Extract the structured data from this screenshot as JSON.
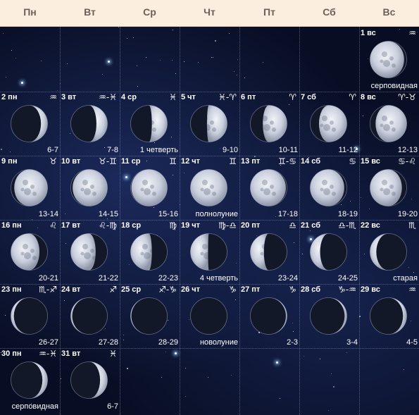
{
  "header": {
    "days": [
      "Пн",
      "Вт",
      "Ср",
      "Чт",
      "Пт",
      "Сб",
      "Вс"
    ]
  },
  "cells": [
    {
      "id": "d1",
      "row": 0,
      "col": 6,
      "date": "1 вс",
      "sign": "♒",
      "label": "серповидная",
      "phase": -0.93
    },
    {
      "id": "d2",
      "row": 1,
      "col": 0,
      "date": "2 пн",
      "sign": "♒",
      "label": "6-7",
      "phase": 0.18
    },
    {
      "id": "d3",
      "row": 1,
      "col": 1,
      "date": "3 вт",
      "sign": "♒-♓",
      "label": "7-8",
      "phase": 0.3
    },
    {
      "id": "d4",
      "row": 1,
      "col": 2,
      "date": "4 ср",
      "sign": "♓",
      "label": "1 четверть",
      "phase": 0.42
    },
    {
      "id": "d5",
      "row": 1,
      "col": 3,
      "date": "5 чт",
      "sign": "♓-♈",
      "label": "9-10",
      "phase": 0.55
    },
    {
      "id": "d6",
      "row": 1,
      "col": 4,
      "date": "6 пт",
      "sign": "♈",
      "label": "10-11",
      "phase": 0.66
    },
    {
      "id": "d7",
      "row": 1,
      "col": 5,
      "date": "7 сб",
      "sign": "♈",
      "label": "11-12",
      "phase": 0.76
    },
    {
      "id": "d8",
      "row": 1,
      "col": 6,
      "date": "8 вс",
      "sign": "♈-♉",
      "label": "12-13",
      "phase": 0.85
    },
    {
      "id": "d9",
      "row": 2,
      "col": 0,
      "date": "9 пн",
      "sign": "♉",
      "label": "13-14",
      "phase": 0.91
    },
    {
      "id": "d10",
      "row": 2,
      "col": 1,
      "date": "10 вт",
      "sign": "♉-♊",
      "label": "14-15",
      "phase": 0.95
    },
    {
      "id": "d11",
      "row": 2,
      "col": 2,
      "date": "11 ср",
      "sign": "♊",
      "label": "15-16",
      "phase": 0.98
    },
    {
      "id": "d12",
      "row": 2,
      "col": 3,
      "date": "12 чт",
      "sign": "♊",
      "label": "полнолуние",
      "phase": 1.0
    },
    {
      "id": "d13",
      "row": 2,
      "col": 4,
      "date": "13 пт",
      "sign": "♊-♋",
      "label": "17-18",
      "phase": -0.97
    },
    {
      "id": "d14",
      "row": 2,
      "col": 5,
      "date": "14 сб",
      "sign": "♋",
      "label": "18-19",
      "phase": -0.93
    },
    {
      "id": "d15",
      "row": 2,
      "col": 6,
      "date": "15 вс",
      "sign": "♋-♌",
      "label": "19-20",
      "phase": -0.87
    },
    {
      "id": "d16",
      "row": 3,
      "col": 0,
      "date": "16 пн",
      "sign": "♌",
      "label": "20-21",
      "phase": -0.78
    },
    {
      "id": "d17",
      "row": 3,
      "col": 1,
      "date": "17 вт",
      "sign": "♌-♍",
      "label": "21-22",
      "phase": -0.68
    },
    {
      "id": "d18",
      "row": 3,
      "col": 2,
      "date": "18 ср",
      "sign": "♍",
      "label": "22-23",
      "phase": -0.58
    },
    {
      "id": "d19",
      "row": 3,
      "col": 3,
      "date": "19 чт",
      "sign": "♍-♎",
      "label": "4 четверть",
      "phase": -0.48
    },
    {
      "id": "d20",
      "row": 3,
      "col": 4,
      "date": "20 пт",
      "sign": "♎",
      "label": "23-24",
      "phase": -0.37
    },
    {
      "id": "d21",
      "row": 3,
      "col": 5,
      "date": "21 сб",
      "sign": "♎-♏",
      "label": "24-25",
      "phase": -0.27
    },
    {
      "id": "d22",
      "row": 3,
      "col": 6,
      "date": "22 вс",
      "sign": "♏",
      "label": "старая",
      "phase": -0.17
    },
    {
      "id": "d23",
      "row": 4,
      "col": 0,
      "date": "23 пн",
      "sign": "♏-♐",
      "label": "26-27",
      "phase": -0.08
    },
    {
      "id": "d24",
      "row": 4,
      "col": 1,
      "date": "24 вт",
      "sign": "♐",
      "label": "27-28",
      "phase": -0.04
    },
    {
      "id": "d25",
      "row": 4,
      "col": 2,
      "date": "25 ср",
      "sign": "♐-♑",
      "label": "28-29",
      "phase": -0.02
    },
    {
      "id": "d26",
      "row": 4,
      "col": 3,
      "date": "26 чт",
      "sign": "♑",
      "label": "новолуние",
      "phase": 0.0
    },
    {
      "id": "d27",
      "row": 4,
      "col": 4,
      "date": "27 пт",
      "sign": "♑",
      "label": "2-3",
      "phase": 0.03
    },
    {
      "id": "d28",
      "row": 4,
      "col": 5,
      "date": "28 сб",
      "sign": "♑-♒",
      "label": "3-4",
      "phase": 0.06
    },
    {
      "id": "d29",
      "row": 4,
      "col": 6,
      "date": "29 вс",
      "sign": "♒",
      "label": "4-5",
      "phase": 0.1
    },
    {
      "id": "d30",
      "row": 5,
      "col": 0,
      "date": "30 пн",
      "sign": "♒-♓",
      "label": "серповидная",
      "phase": 0.14
    },
    {
      "id": "d31",
      "row": 5,
      "col": 1,
      "date": "31 вт",
      "sign": "♓",
      "label": "6-7",
      "phase": 0.2
    }
  ],
  "colors": {
    "header_bg": "#fbeede",
    "header_text": "#6b6058",
    "sky": "#070d22",
    "moon_lit": "#d9dde8",
    "moon_dark": "#121828"
  }
}
